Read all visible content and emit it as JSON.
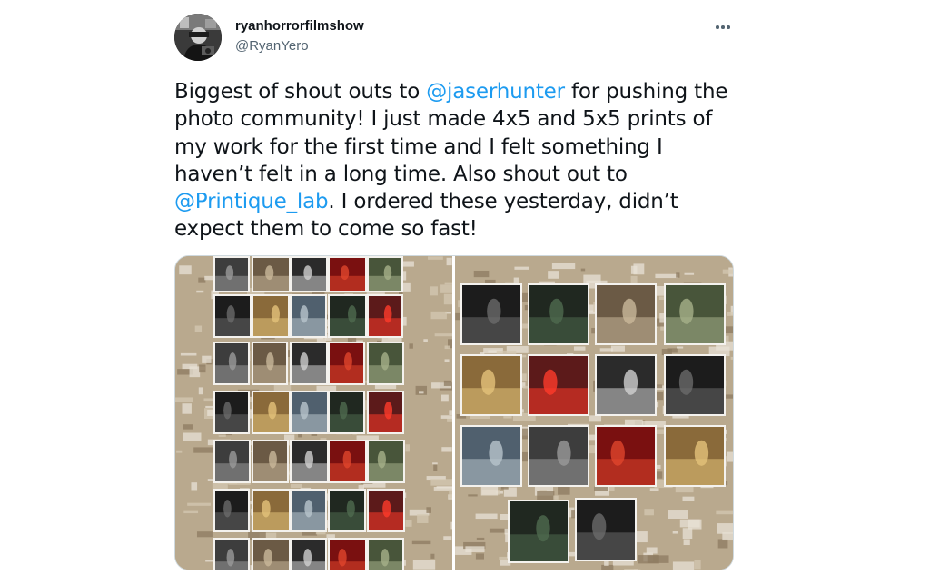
{
  "user": {
    "display_name": "ryanhorrorfilmshow",
    "handle": "@RyanYero",
    "avatar_icon": "profile-avatar"
  },
  "tweet": {
    "text_part1": "Biggest of shout outs to ",
    "mention1": "@jaserhunter",
    "text_part2": " for pushing the photo community! I just made 4x5 and 5x5 prints of my work for the first time and I felt something I haven’t felt in a long time. Also shout out to ",
    "mention2": "@Printique_lab",
    "text_part3": ". I ordered these yesterday, didn’t expect them to come so fast!"
  },
  "icons": {
    "more": "more-horizontal-icon"
  },
  "colors": {
    "text_primary": "#0f1419",
    "text_secondary": "#536471",
    "link": "#1d9bf0",
    "wall": "#b7a68b"
  },
  "media": {
    "count": 2
  }
}
